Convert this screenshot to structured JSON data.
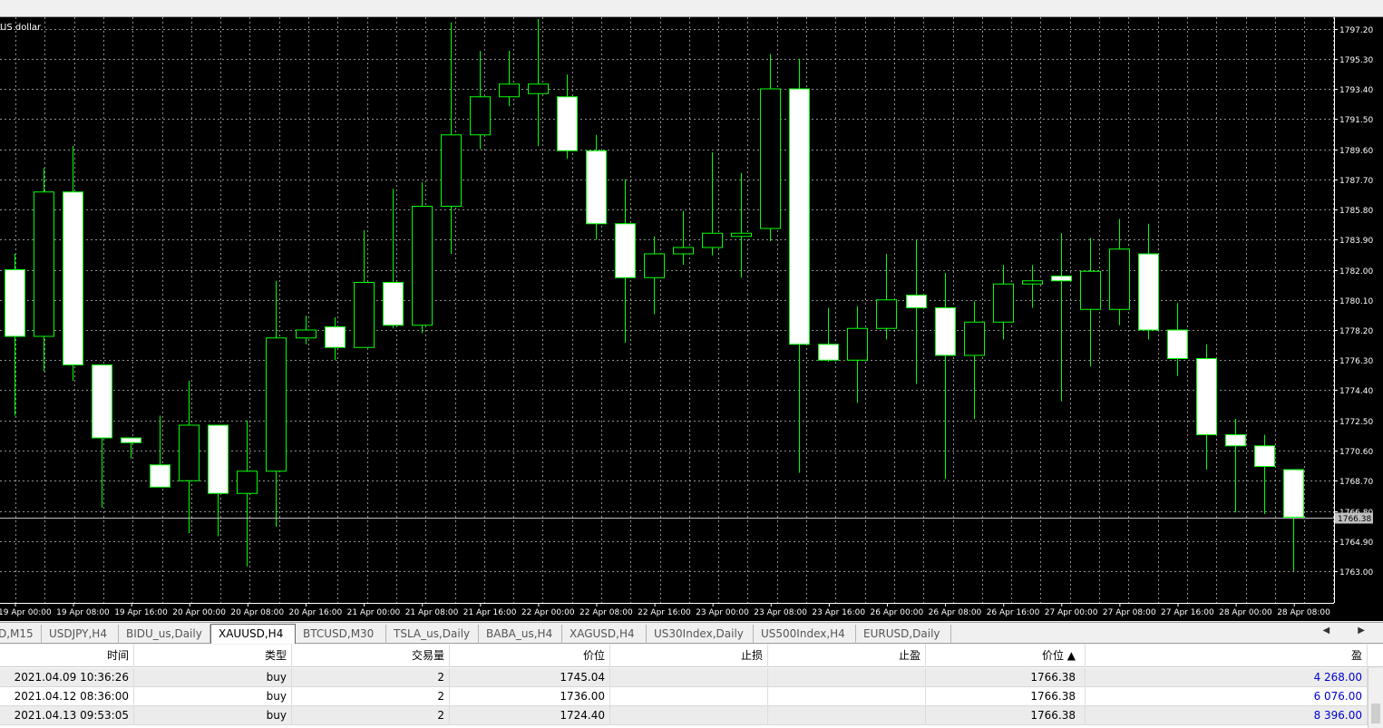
{
  "chart": {
    "symbol_title": "US dollar",
    "current_price_label": "1766.38",
    "colors": {
      "background": "#000000",
      "grid": "#c0c0c0",
      "candle_outline": "#00ff00",
      "bull_body": "#000000",
      "bear_body": "#ffffff",
      "axis_text": "#ffffff",
      "current_price_line": "#c0c0c0"
    }
  },
  "chart_data": {
    "type": "candlestick",
    "title": "US dollar",
    "symbol": "XAUUSD",
    "timeframe": "H4",
    "ylim": [
      1761.5,
      1798.5
    ],
    "y_ticks": [
      "1797.20",
      "1795.30",
      "1793.40",
      "1791.50",
      "1789.60",
      "1787.70",
      "1785.80",
      "1783.90",
      "1782.00",
      "1780.10",
      "1778.20",
      "1776.30",
      "1774.40",
      "1772.50",
      "1770.60",
      "1768.70",
      "1766.80",
      "1764.90",
      "1763.00"
    ],
    "x_ticks": [
      "19 Apr 00:00",
      "19 Apr 08:00",
      "19 Apr 16:00",
      "20 Apr 00:00",
      "20 Apr 08:00",
      "20 Apr 16:00",
      "21 Apr 00:00",
      "21 Apr 08:00",
      "21 Apr 16:00",
      "22 Apr 00:00",
      "22 Apr 08:00",
      "22 Apr 16:00",
      "23 Apr 00:00",
      "23 Apr 08:00",
      "23 Apr 16:00",
      "26 Apr 00:00",
      "26 Apr 08:00",
      "26 Apr 16:00",
      "27 Apr 00:00",
      "27 Apr 08:00",
      "27 Apr 16:00",
      "28 Apr 00:00",
      "28 Apr 08:00"
    ],
    "grid": true,
    "current_price": 1766.38,
    "candles": [
      {
        "o": 1782.0,
        "h": 1783.0,
        "l": 1772.8,
        "c": 1777.8
      },
      {
        "o": 1777.8,
        "h": 1788.4,
        "l": 1775.6,
        "c": 1786.9
      },
      {
        "o": 1786.9,
        "h": 1789.8,
        "l": 1775.0,
        "c": 1776.0
      },
      {
        "o": 1776.0,
        "h": 1776.0,
        "l": 1767.0,
        "c": 1771.4
      },
      {
        "o": 1771.4,
        "h": 1771.4,
        "l": 1770.1,
        "c": 1771.1
      },
      {
        "o": 1769.7,
        "h": 1772.8,
        "l": 1768.7,
        "c": 1768.3
      },
      {
        "o": 1768.7,
        "h": 1775.0,
        "l": 1765.4,
        "c": 1772.2
      },
      {
        "o": 1772.2,
        "h": 1772.2,
        "l": 1765.2,
        "c": 1767.9
      },
      {
        "o": 1767.9,
        "h": 1772.5,
        "l": 1763.3,
        "c": 1769.3
      },
      {
        "o": 1769.3,
        "h": 1781.3,
        "l": 1765.8,
        "c": 1777.7
      },
      {
        "o": 1777.7,
        "h": 1779.1,
        "l": 1777.3,
        "c": 1778.2
      },
      {
        "o": 1778.4,
        "h": 1779.0,
        "l": 1776.3,
        "c": 1777.1
      },
      {
        "o": 1777.1,
        "h": 1784.5,
        "l": 1777.1,
        "c": 1781.2
      },
      {
        "o": 1781.2,
        "h": 1787.1,
        "l": 1778.3,
        "c": 1778.5
      },
      {
        "o": 1778.5,
        "h": 1787.5,
        "l": 1778.0,
        "c": 1786.0
      },
      {
        "o": 1786.0,
        "h": 1797.6,
        "l": 1783.0,
        "c": 1790.5
      },
      {
        "o": 1790.5,
        "h": 1795.8,
        "l": 1789.6,
        "c": 1792.9
      },
      {
        "o": 1792.9,
        "h": 1795.8,
        "l": 1792.3,
        "c": 1793.7
      },
      {
        "o": 1793.1,
        "h": 1797.8,
        "l": 1789.8,
        "c": 1793.7
      },
      {
        "o": 1792.9,
        "h": 1794.3,
        "l": 1789.0,
        "c": 1789.5
      },
      {
        "o": 1789.5,
        "h": 1790.5,
        "l": 1783.9,
        "c": 1784.9
      },
      {
        "o": 1784.9,
        "h": 1787.7,
        "l": 1777.4,
        "c": 1781.5
      },
      {
        "o": 1781.5,
        "h": 1784.1,
        "l": 1779.2,
        "c": 1783.0
      },
      {
        "o": 1783.0,
        "h": 1785.7,
        "l": 1782.3,
        "c": 1783.4
      },
      {
        "o": 1783.4,
        "h": 1789.4,
        "l": 1782.9,
        "c": 1784.3
      },
      {
        "o": 1784.1,
        "h": 1788.1,
        "l": 1781.5,
        "c": 1784.3
      },
      {
        "o": 1784.6,
        "h": 1795.6,
        "l": 1783.8,
        "c": 1793.4
      },
      {
        "o": 1793.4,
        "h": 1795.3,
        "l": 1769.2,
        "c": 1777.3
      },
      {
        "o": 1777.3,
        "h": 1779.6,
        "l": 1776.2,
        "c": 1776.3
      },
      {
        "o": 1776.3,
        "h": 1779.7,
        "l": 1773.6,
        "c": 1778.3
      },
      {
        "o": 1778.3,
        "h": 1783.0,
        "l": 1777.6,
        "c": 1780.1
      },
      {
        "o": 1780.4,
        "h": 1783.9,
        "l": 1774.8,
        "c": 1779.6
      },
      {
        "o": 1779.6,
        "h": 1781.8,
        "l": 1768.8,
        "c": 1776.6
      },
      {
        "o": 1776.6,
        "h": 1780.0,
        "l": 1772.6,
        "c": 1778.7
      },
      {
        "o": 1778.7,
        "h": 1782.3,
        "l": 1777.6,
        "c": 1781.1
      },
      {
        "o": 1781.1,
        "h": 1782.3,
        "l": 1779.6,
        "c": 1781.3
      },
      {
        "o": 1781.6,
        "h": 1784.3,
        "l": 1773.7,
        "c": 1781.3
      },
      {
        "o": 1779.5,
        "h": 1784.0,
        "l": 1775.9,
        "c": 1781.9
      },
      {
        "o": 1779.5,
        "h": 1785.2,
        "l": 1778.5,
        "c": 1783.3
      },
      {
        "o": 1783.0,
        "h": 1784.9,
        "l": 1777.6,
        "c": 1778.2
      },
      {
        "o": 1778.2,
        "h": 1779.9,
        "l": 1775.3,
        "c": 1776.4
      },
      {
        "o": 1776.4,
        "h": 1777.3,
        "l": 1769.4,
        "c": 1771.6
      },
      {
        "o": 1771.6,
        "h": 1772.6,
        "l": 1766.7,
        "c": 1770.9
      },
      {
        "o": 1770.9,
        "h": 1771.6,
        "l": 1766.6,
        "c": 1769.6
      },
      {
        "o": 1769.4,
        "h": 1769.4,
        "l": 1763.0,
        "c": 1766.4
      }
    ]
  },
  "tabs": [
    {
      "label": "D,M15",
      "active": false
    },
    {
      "label": "USDJPY,H4",
      "active": false
    },
    {
      "label": "BIDU_us,Daily",
      "active": false
    },
    {
      "label": "XAUUSD,H4",
      "active": true
    },
    {
      "label": "BTCUSD,M30",
      "active": false
    },
    {
      "label": "TSLA_us,Daily",
      "active": false
    },
    {
      "label": "BABA_us,H4",
      "active": false
    },
    {
      "label": "XAGUSD,H4",
      "active": false
    },
    {
      "label": "US30Index,Daily",
      "active": false
    },
    {
      "label": "US500Index,H4",
      "active": false
    },
    {
      "label": "EURUSD,Daily",
      "active": false
    }
  ],
  "tab_scroll": "◀ ▶",
  "table": {
    "headers": [
      "时间",
      "类型",
      "交易量",
      "价位",
      "止损",
      "止盈",
      "价位 ▲",
      "盈"
    ],
    "rows": [
      [
        "2021.04.09 10:36:26",
        "buy",
        "2",
        "1745.04",
        "",
        "",
        "1766.38",
        "4 268.00"
      ],
      [
        "2021.04.12 08:36:00",
        "buy",
        "2",
        "1736.00",
        "",
        "",
        "1766.38",
        "6 076.00"
      ],
      [
        "2021.04.13 09:53:05",
        "buy",
        "2",
        "1724.40",
        "",
        "",
        "1766.38",
        "8 396.00"
      ]
    ]
  }
}
